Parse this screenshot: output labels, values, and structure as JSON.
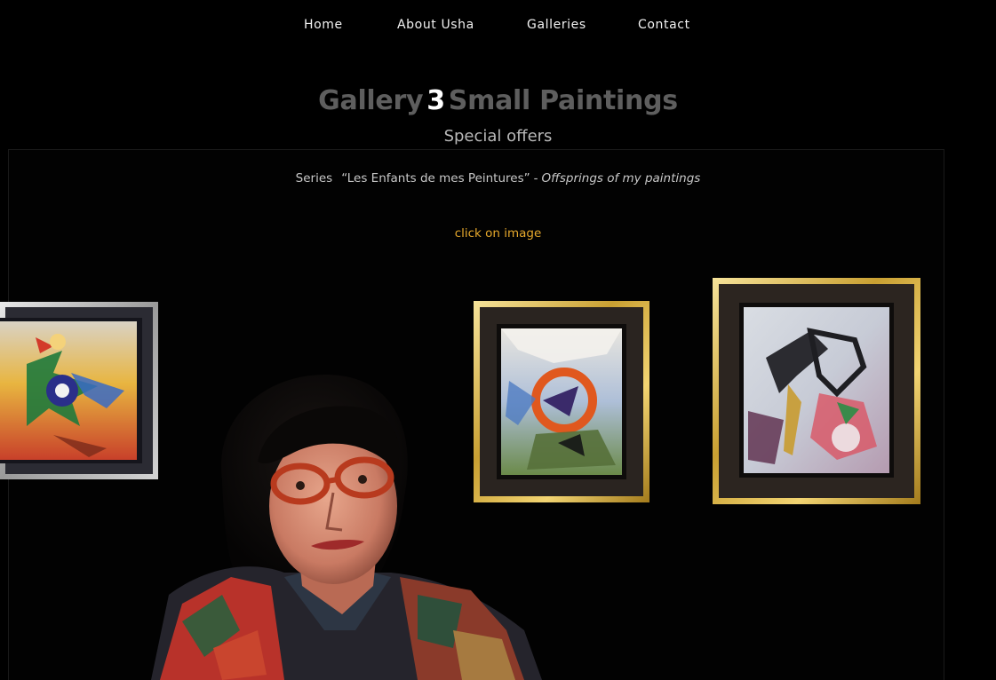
{
  "nav": {
    "items": [
      {
        "label": "Home"
      },
      {
        "label": "About Usha"
      },
      {
        "label": "Galleries"
      },
      {
        "label": "Contact"
      }
    ]
  },
  "header": {
    "title_word": "Gallery",
    "title_number": "3",
    "title_rest": "Small Paintings",
    "subtitle": "Special offers"
  },
  "series": {
    "label": "Series",
    "name": "“Les Enfants de mes Peintures”",
    "separator": "-",
    "translation": "Offsprings of my paintings"
  },
  "hint": {
    "text": "click on image",
    "color": "#e6a82c"
  },
  "paintings": [
    {
      "name": "painting-1",
      "frame": "silver"
    },
    {
      "name": "painting-2",
      "frame": "gold"
    },
    {
      "name": "painting-3",
      "frame": "gold"
    }
  ],
  "colors": {
    "background": "#000000",
    "title_gray": "#5e5e5e",
    "accent_orange": "#e6a82c"
  }
}
